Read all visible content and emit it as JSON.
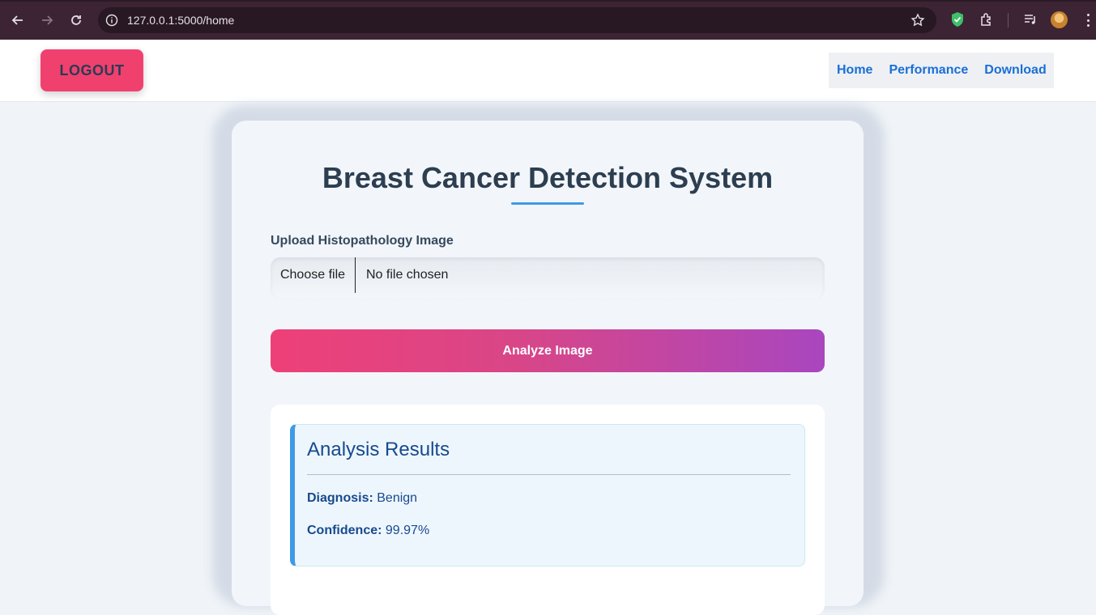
{
  "browser": {
    "url": "127.0.0.1:5000/home"
  },
  "header": {
    "logout_label": "LOGOUT",
    "nav": [
      {
        "label": "Home"
      },
      {
        "label": "Performance"
      },
      {
        "label": "Download"
      }
    ]
  },
  "main": {
    "title": "Breast Cancer Detection System",
    "upload_label": "Upload Histopathology Image",
    "file_button_label": "Choose file",
    "file_status": "No file chosen",
    "analyze_label": "Analyze Image"
  },
  "results": {
    "heading": "Analysis Results",
    "diagnosis_label": "Diagnosis:",
    "diagnosis_value": "Benign",
    "confidence_label": "Confidence:",
    "confidence_value": "99.97%"
  },
  "colors": {
    "accent_pink": "#f0416e",
    "link_blue": "#1a6fd6",
    "results_text": "#164a8e",
    "gradient_start": "#ee4078",
    "gradient_end": "#a946bf"
  }
}
